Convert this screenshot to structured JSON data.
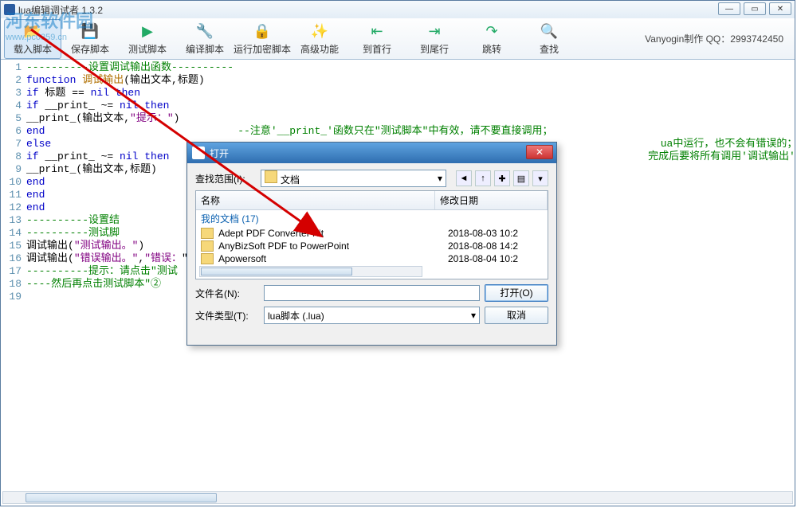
{
  "app": {
    "title": "lua编辑调试者 1.3.2"
  },
  "watermark": {
    "line1": "河东软件园",
    "line2": "www.pc0359.cn"
  },
  "winbtns": {
    "min": "—",
    "max": "▭",
    "close": "✕"
  },
  "toolbar": {
    "items": [
      {
        "label": "载入脚本",
        "glyph": "📂",
        "selected": true
      },
      {
        "label": "保存脚本",
        "glyph": "💾"
      },
      {
        "label": "测试脚本",
        "glyph": "▶"
      },
      {
        "label": "编译脚本",
        "glyph": "🔧"
      },
      {
        "label": "运行加密脚本",
        "glyph": "🔒"
      },
      {
        "label": "高级功能",
        "glyph": "✨"
      },
      {
        "label": "到首行",
        "glyph": "⇤"
      },
      {
        "label": "到尾行",
        "glyph": "⇥"
      },
      {
        "label": "跳转",
        "glyph": "↷"
      },
      {
        "label": "查找",
        "glyph": "🔍"
      }
    ],
    "credit": "Vanyogin制作 QQ：2993742450"
  },
  "code": {
    "lines": [
      {
        "n": 1,
        "seg": [
          [
            "c-comment",
            "----------设置调试输出函数----------"
          ]
        ]
      },
      {
        "n": 2,
        "seg": [
          [
            "c-keyword",
            "function "
          ],
          [
            "c-func",
            "调试输出"
          ],
          [
            "c-ident",
            "(输出文本,标题)"
          ]
        ]
      },
      {
        "n": 3,
        "seg": [
          [
            "c-keyword",
            "if "
          ],
          [
            "c-ident",
            "标题 == "
          ],
          [
            "c-keyword",
            "nil then"
          ]
        ]
      },
      {
        "n": 4,
        "seg": [
          [
            "c-keyword",
            "if "
          ],
          [
            "c-ident",
            "__print_ ~= "
          ],
          [
            "c-keyword",
            "nil then"
          ]
        ]
      },
      {
        "n": 5,
        "seg": [
          [
            "c-ident",
            "__print_(输出文本,"
          ],
          [
            "c-string",
            "\"提示：\""
          ],
          [
            "c-ident",
            ")"
          ]
        ]
      },
      {
        "n": 6,
        "seg": [
          [
            "c-keyword",
            "end"
          ],
          [
            "c-ident",
            "                               "
          ],
          [
            "c-comment",
            "--注意'__print_'函数只在\"测试脚本\"中有效，请不要直接调用；"
          ]
        ]
      },
      {
        "n": 7,
        "seg": [
          [
            "c-keyword",
            "else"
          ],
          [
            "c-ident",
            "                                                                                                  "
          ],
          [
            "c-comment",
            "ua中运行，也不会有错误的；"
          ]
        ]
      },
      {
        "n": 8,
        "seg": [
          [
            "c-keyword",
            "if "
          ],
          [
            "c-ident",
            "__print_ ~= "
          ],
          [
            "c-keyword",
            "nil then"
          ],
          [
            "c-ident",
            "                                                                             "
          ],
          [
            "c-comment",
            "完成后要将所有调用'调试输出'函数全都删除的麻烦。"
          ]
        ]
      },
      {
        "n": 9,
        "seg": [
          [
            "c-ident",
            "__print_(输出文本,标题)"
          ]
        ]
      },
      {
        "n": 10,
        "seg": [
          [
            "c-keyword",
            "end"
          ]
        ]
      },
      {
        "n": 11,
        "seg": [
          [
            "c-keyword",
            "end"
          ]
        ]
      },
      {
        "n": 12,
        "seg": [
          [
            "c-keyword",
            "end"
          ]
        ]
      },
      {
        "n": 13,
        "seg": [
          [
            "c-comment",
            "----------设置结"
          ]
        ]
      },
      {
        "n": 14,
        "seg": [
          [
            "c-ident",
            ""
          ]
        ]
      },
      {
        "n": 15,
        "seg": [
          [
            "c-comment",
            "----------测试脚"
          ]
        ]
      },
      {
        "n": 16,
        "seg": [
          [
            "c-ident",
            "调试输出("
          ],
          [
            "c-string",
            "\"测试输出。\""
          ],
          [
            "c-ident",
            ")"
          ]
        ]
      },
      {
        "n": 17,
        "seg": [
          [
            "c-ident",
            "调试输出("
          ],
          [
            "c-string",
            "\"错误输出。\""
          ],
          [
            "c-ident",
            ","
          ],
          [
            "c-string",
            "\"错误："
          ],
          [
            "c-ident",
            "\""
          ]
        ]
      },
      {
        "n": 18,
        "seg": [
          [
            "c-comment",
            "----------提示：请点击\"测试"
          ]
        ]
      },
      {
        "n": 19,
        "seg": [
          [
            "c-comment",
            "----然后再点击测试脚本\"②"
          ]
        ]
      }
    ]
  },
  "dialog": {
    "title": "打开",
    "lookin_label": "查找范围(I):",
    "lookin_value": "文档",
    "nav": {
      "back": "◄",
      "up": "↑",
      "newfolder": "✚",
      "views": "▤",
      "drop": "▾"
    },
    "cols": {
      "name": "名称",
      "date": "修改日期"
    },
    "group": "我的文档 (17)",
    "items": [
      {
        "name": "Adept PDF Converter Kit",
        "date": "2018-08-03 10:2"
      },
      {
        "name": "AnyBizSoft PDF to PowerPoint",
        "date": "2018-08-08 14:2"
      },
      {
        "name": "Apowersoft",
        "date": "2018-08-04 10:2"
      }
    ],
    "filename_label": "文件名(N):",
    "filename_value": "",
    "filetype_label": "文件类型(T):",
    "filetype_value": "lua脚本 (.lua)",
    "open_btn": "打开(O)",
    "cancel_btn": "取消",
    "dropdown_glyph": "▾"
  }
}
